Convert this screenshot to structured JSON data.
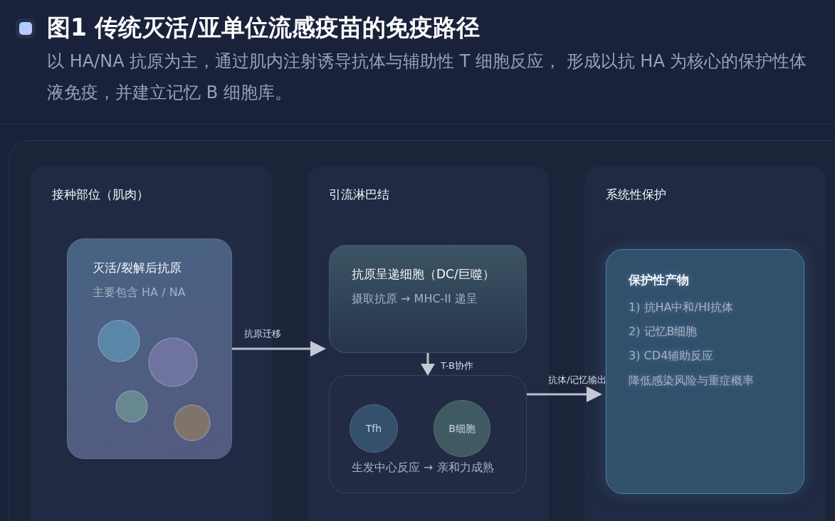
{
  "header": {
    "title": "图1 传统灭活/亚单位流感疫苗的免疫路径",
    "subtitle": "以 HA/NA 抗原为主，通过肌内注射诱导抗体与辅助性 T 细胞反应， 形成以抗 HA 为核心的保护性体液免疫，并建立记忆 B 细胞库。"
  },
  "columns": [
    {
      "title": "接种部位（肌肉）"
    },
    {
      "title": "引流淋巴结"
    },
    {
      "title": "系统性保护"
    }
  ],
  "antigen_box": {
    "title": "灭活/裂解后抗原",
    "subtitle": "主要包含 HA / NA",
    "particles": [
      {
        "color": "#5a86a8"
      },
      {
        "color": "#6f73a0"
      },
      {
        "color": "#678891"
      },
      {
        "color": "#7e7469"
      }
    ]
  },
  "apc_box": {
    "title": "抗原呈递细胞（DC/巨噬）",
    "subtitle": "摄取抗原 → MHC-II 递呈"
  },
  "gc_box": {
    "cells": [
      {
        "label": "Tfh",
        "kind": "tfh"
      },
      {
        "label": "B细胞",
        "kind": "bcell"
      }
    ],
    "caption": "生发中心反应 → 亲和力成熟"
  },
  "protection_box": {
    "title": "保护性产物",
    "items": [
      "1) 抗HA中和/HI抗体",
      "2) 记忆B细胞",
      "3) CD4辅助反应",
      "降低感染风险与重症概率"
    ]
  },
  "arrows": [
    {
      "label": "抗原迁移",
      "kind": "right1"
    },
    {
      "label": "T-B协作",
      "kind": "down"
    },
    {
      "label": "抗体/记忆输出",
      "kind": "right2"
    }
  ]
}
